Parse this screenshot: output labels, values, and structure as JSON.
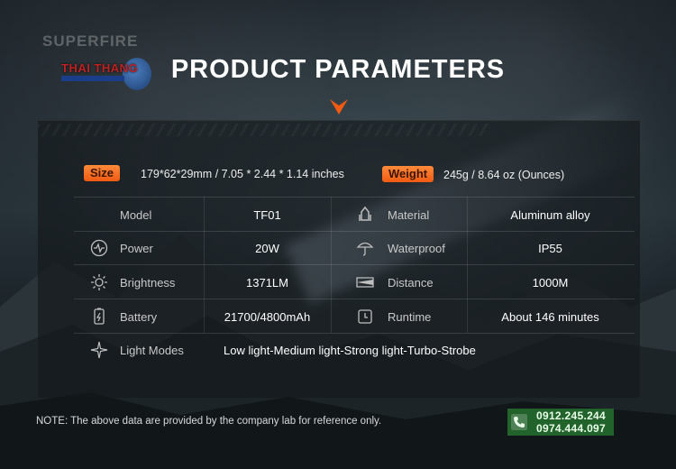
{
  "brand": "SUPERFIRE",
  "logo": {
    "text": "THAI THANG"
  },
  "title": "PRODUCT PARAMETERS",
  "size": {
    "label": "Size",
    "value": "179*62*29mm / 7.05 * 2.44 * 1.14 inches"
  },
  "weight": {
    "label": "Weight",
    "value": "245g / 8.64 oz (Ounces)"
  },
  "specs": {
    "model": {
      "label": "Model",
      "value": "TF01"
    },
    "material": {
      "label": "Material",
      "value": "Aluminum alloy"
    },
    "power": {
      "label": "Power",
      "value": "20W"
    },
    "waterproof": {
      "label": "Waterproof",
      "value": "IP55"
    },
    "brightness": {
      "label": "Brightness",
      "value": "1371LM"
    },
    "distance": {
      "label": "Distance",
      "value": "1000M"
    },
    "battery": {
      "label": "Battery",
      "value": "21700/4800mAh"
    },
    "runtime": {
      "label": "Runtime",
      "value": "About 146 minutes"
    },
    "light_modes": {
      "label": "Light Modes",
      "value": "Low light-Medium light-Strong light-Turbo-Strobe"
    }
  },
  "note": "NOTE: The above data are provided by the company lab for reference only.",
  "contact": {
    "phone1": "0912.245.244",
    "phone2": "0974.444.097"
  },
  "colors": {
    "accent": "#f05a12",
    "badge_text": "#3a1504",
    "contact_bg": "#287832"
  },
  "icons": [
    "power-icon",
    "brightness-icon",
    "battery-icon",
    "light-modes-icon",
    "material-icon",
    "waterproof-icon",
    "distance-icon",
    "runtime-icon",
    "phone-icon"
  ]
}
